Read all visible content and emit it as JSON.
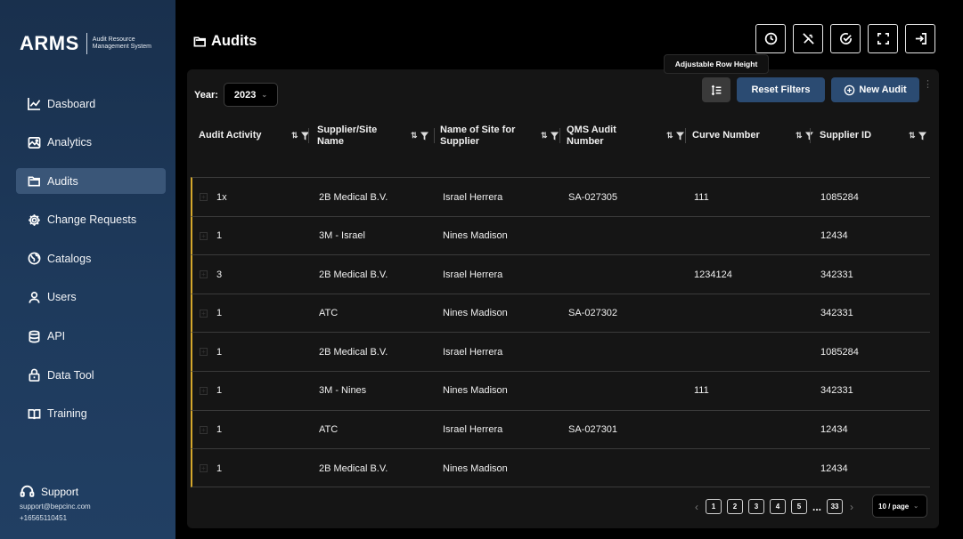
{
  "brand": {
    "name": "ARMS",
    "subtitle": "Audit Resource Management System"
  },
  "sidebar": {
    "items": [
      {
        "label": "Dasboard",
        "icon": "chart-line-icon",
        "active": false
      },
      {
        "label": "Analytics",
        "icon": "analytics-icon",
        "active": false
      },
      {
        "label": "Audits",
        "icon": "folder-icon",
        "active": true
      },
      {
        "label": "Change Requests",
        "icon": "gear-icon",
        "active": false
      },
      {
        "label": "Catalogs",
        "icon": "globe-icon",
        "active": false
      },
      {
        "label": "Users",
        "icon": "user-icon",
        "active": false
      },
      {
        "label": "API",
        "icon": "database-icon",
        "active": false
      },
      {
        "label": "Data Tool",
        "icon": "lock-icon",
        "active": false
      },
      {
        "label": "Training",
        "icon": "book-icon",
        "active": false
      }
    ],
    "support": {
      "label": "Support",
      "email": "support@bepcinc.com",
      "phone": "+16565110451"
    }
  },
  "header": {
    "title": "Audits"
  },
  "toolbar": {
    "year_label": "Year:",
    "year_value": "2023",
    "tooltip": "Adjustable Row Height",
    "reset_label": "Reset Filters",
    "new_label": "New Audit"
  },
  "table": {
    "columns": [
      "Audit Activity",
      "Supplier/Site Name",
      "Name of Site for Supplier",
      "QMS Audit Number",
      "Curve Number",
      "Supplier ID"
    ],
    "rows": [
      [
        "1x",
        "2B Medical B.V.",
        "Israel Herrera",
        "SA-027305",
        "111",
        "1085284"
      ],
      [
        "1",
        "3M - Israel",
        "Nines Madison",
        "",
        "",
        "12434"
      ],
      [
        "3",
        "2B Medical B.V.",
        "Israel Herrera",
        "",
        "1234124",
        "342331"
      ],
      [
        "1",
        "ATC",
        "Nines Madison",
        "SA-027302",
        "",
        "342331"
      ],
      [
        "1",
        "2B Medical B.V.",
        "Israel Herrera",
        "",
        "",
        "1085284"
      ],
      [
        "1",
        "3M - Nines",
        "Nines Madison",
        "",
        "111",
        "342331"
      ],
      [
        "1",
        "ATC",
        "Israel Herrera",
        "SA-027301",
        "",
        "12434"
      ],
      [
        "1",
        "2B Medical B.V.",
        "Nines Madison",
        "",
        "",
        "12434"
      ]
    ]
  },
  "pagination": {
    "pages": [
      "1",
      "2",
      "3",
      "4",
      "5"
    ],
    "ellipsis": "...",
    "last": "33",
    "per_page": "10 / page"
  }
}
